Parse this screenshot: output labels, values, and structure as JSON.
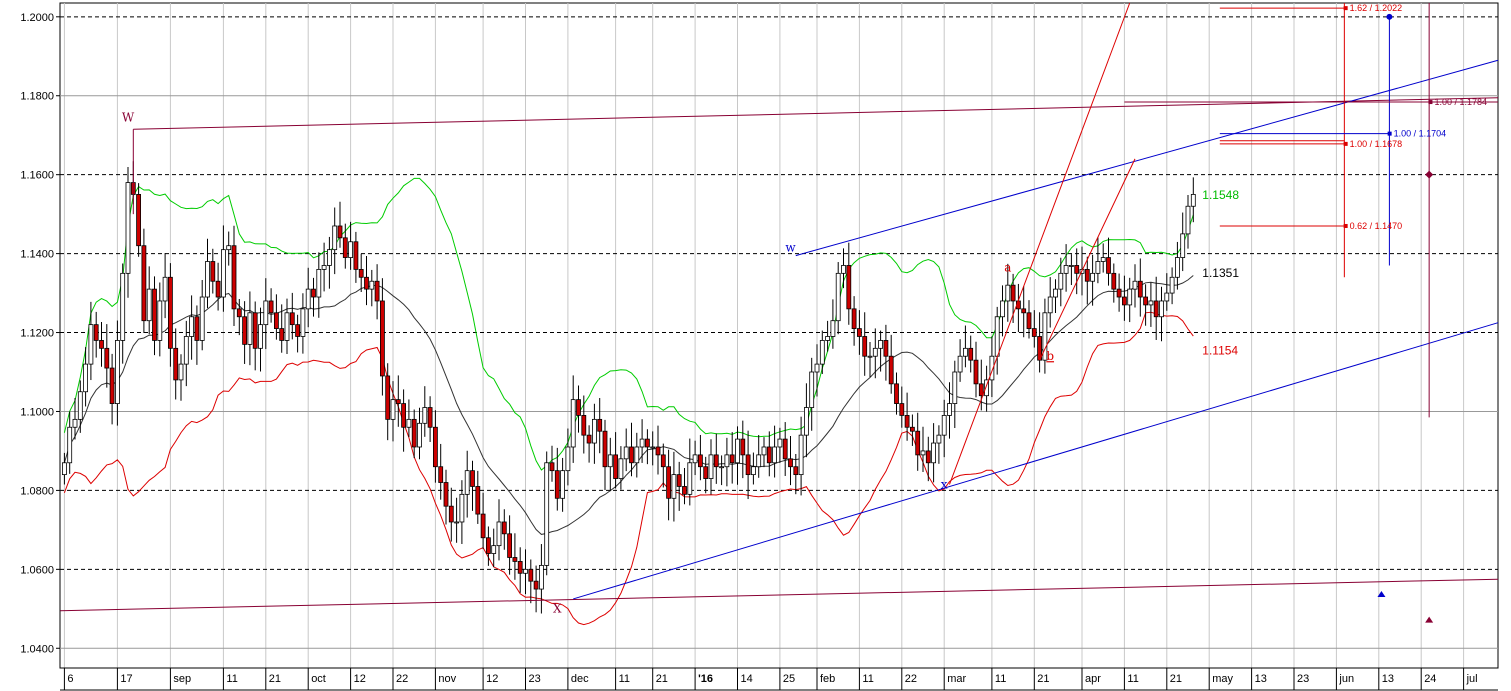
{
  "chart_data": {
    "type": "candlestick",
    "ylim": [
      1.035,
      1.2035
    ],
    "y_ticks": [
      1.04,
      1.06,
      1.08,
      1.1,
      1.12,
      1.14,
      1.16,
      1.18,
      1.2
    ],
    "y_tick_labels": [
      "1.0400",
      "1.0600",
      "1.0800",
      "1.1000",
      "1.1200",
      "1.1400",
      "1.1600",
      "1.1800",
      "1.2000"
    ],
    "y_dashed": [
      1.06,
      1.08,
      1.12,
      1.14,
      1.16,
      1.2
    ],
    "x_ticks": [
      {
        "i": 0,
        "label": "6"
      },
      {
        "i": 10,
        "label": "17"
      },
      {
        "i": 20,
        "label": "sep"
      },
      {
        "i": 30,
        "label": "11"
      },
      {
        "i": 38,
        "label": "21"
      },
      {
        "i": 46,
        "label": "oct"
      },
      {
        "i": 54,
        "label": "12"
      },
      {
        "i": 62,
        "label": "22"
      },
      {
        "i": 70,
        "label": "nov"
      },
      {
        "i": 79,
        "label": "12"
      },
      {
        "i": 87,
        "label": "23"
      },
      {
        "i": 95,
        "label": "dec"
      },
      {
        "i": 104,
        "label": "11"
      },
      {
        "i": 111,
        "label": "21"
      },
      {
        "i": 119,
        "label": "'16"
      },
      {
        "i": 127,
        "label": "14"
      },
      {
        "i": 135,
        "label": "25"
      },
      {
        "i": 142,
        "label": "feb"
      },
      {
        "i": 150,
        "label": "11"
      },
      {
        "i": 158,
        "label": "22"
      },
      {
        "i": 166,
        "label": "mar"
      },
      {
        "i": 175,
        "label": "11"
      },
      {
        "i": 183,
        "label": "21"
      },
      {
        "i": 192,
        "label": "apr"
      },
      {
        "i": 200,
        "label": "11"
      },
      {
        "i": 208,
        "label": "21"
      },
      {
        "i": 216,
        "label": "may"
      },
      {
        "i": 224,
        "label": "13"
      },
      {
        "i": 232,
        "label": "23"
      },
      {
        "i": 240,
        "label": "jun"
      },
      {
        "i": 248,
        "label": "13"
      },
      {
        "i": 256,
        "label": "24"
      },
      {
        "i": 264,
        "label": "jul"
      }
    ],
    "closes": [
      1.087,
      1.096,
      1.098,
      1.105,
      1.112,
      1.122,
      1.118,
      1.116,
      1.111,
      1.102,
      1.118,
      1.135,
      1.158,
      1.155,
      1.142,
      1.123,
      1.131,
      1.118,
      1.128,
      1.134,
      1.116,
      1.108,
      1.112,
      1.119,
      1.124,
      1.118,
      1.129,
      1.138,
      1.133,
      1.129,
      1.141,
      1.142,
      1.126,
      1.124,
      1.117,
      1.125,
      1.116,
      1.122,
      1.128,
      1.125,
      1.121,
      1.118,
      1.125,
      1.122,
      1.119,
      1.126,
      1.131,
      1.129,
      1.136,
      1.137,
      1.141,
      1.147,
      1.144,
      1.139,
      1.143,
      1.136,
      1.134,
      1.131,
      1.133,
      1.128,
      1.109,
      1.098,
      1.103,
      1.102,
      1.096,
      1.098,
      1.091,
      1.097,
      1.101,
      1.096,
      1.086,
      1.082,
      1.076,
      1.072,
      1.072,
      1.079,
      1.085,
      1.081,
      1.074,
      1.068,
      1.064,
      1.066,
      1.072,
      1.069,
      1.063,
      1.062,
      1.059,
      1.06,
      1.057,
      1.055,
      1.061,
      1.087,
      1.085,
      1.078,
      1.085,
      1.091,
      1.103,
      1.099,
      1.094,
      1.092,
      1.098,
      1.095,
      1.086,
      1.089,
      1.083,
      1.088,
      1.091,
      1.087,
      1.091,
      1.093,
      1.091,
      1.091,
      1.089,
      1.086,
      1.078,
      1.084,
      1.081,
      1.079,
      1.087,
      1.089,
      1.086,
      1.083,
      1.089,
      1.086,
      1.086,
      1.089,
      1.087,
      1.093,
      1.089,
      1.084,
      1.086,
      1.089,
      1.091,
      1.087,
      1.091,
      1.093,
      1.088,
      1.086,
      1.084,
      1.094,
      1.101,
      1.11,
      1.112,
      1.118,
      1.119,
      1.123,
      1.135,
      1.137,
      1.126,
      1.121,
      1.119,
      1.114,
      1.114,
      1.116,
      1.118,
      1.114,
      1.107,
      1.102,
      1.099,
      1.096,
      1.095,
      1.089,
      1.09,
      1.087,
      1.092,
      1.094,
      1.099,
      1.102,
      1.11,
      1.114,
      1.116,
      1.113,
      1.107,
      1.104,
      1.108,
      1.114,
      1.124,
      1.128,
      1.132,
      1.128,
      1.126,
      1.125,
      1.121,
      1.119,
      1.113,
      1.125,
      1.129,
      1.131,
      1.135,
      1.137,
      1.137,
      1.135,
      1.136,
      1.133,
      1.135,
      1.138,
      1.139,
      1.135,
      1.131,
      1.129,
      1.127,
      1.131,
      1.133,
      1.129,
      1.127,
      1.128,
      1.124,
      1.128,
      1.13,
      1.134,
      1.139,
      1.145,
      1.152,
      1.155
    ],
    "bands": {
      "upper": {
        "color": "#00cc00"
      },
      "middle": {
        "color": "#333333"
      },
      "lower": {
        "color": "#dd0000"
      }
    },
    "level_labels": [
      {
        "text": "1.1548",
        "value": 1.1548,
        "color": "#00bb00"
      },
      {
        "text": "1.1351",
        "value": 1.1351,
        "color": "#000000"
      },
      {
        "text": "1.1154",
        "value": 1.1154,
        "color": "#dd0000"
      }
    ],
    "fib_labels": [
      {
        "text": "1.62 / 1.2022",
        "value": 1.2022,
        "color": "#dd0000",
        "col": "red"
      },
      {
        "text": "1.00 / 1.1784",
        "value": 1.1784,
        "color": "#880033",
        "col": "maroon"
      },
      {
        "text": "1.00 / 1.1704",
        "value": 1.1704,
        "color": "#0000cc",
        "col": "blue"
      },
      {
        "text": "1.00 / 1.1678",
        "value": 1.1678,
        "color": "#dd0000",
        "col": "red"
      },
      {
        "text": "0.62 / 1.1470",
        "value": 1.147,
        "color": "#dd0000",
        "col": "red"
      }
    ],
    "wave_labels": [
      {
        "text": "W",
        "i": 12,
        "value": 1.1735,
        "color": "#880033"
      },
      {
        "text": "X",
        "i": 93,
        "value": 1.049,
        "color": "#880033"
      },
      {
        "text": "w",
        "i": 137,
        "value": 1.1405,
        "color": "#0000cc"
      },
      {
        "text": "x",
        "i": 166,
        "value": 1.0805,
        "color": "#0000cc"
      },
      {
        "text": "a",
        "i": 178,
        "value": 1.1355,
        "color": "#dd0000"
      },
      {
        "text": "b",
        "i": 186,
        "value": 1.113,
        "color": "#dd0000"
      }
    ]
  }
}
